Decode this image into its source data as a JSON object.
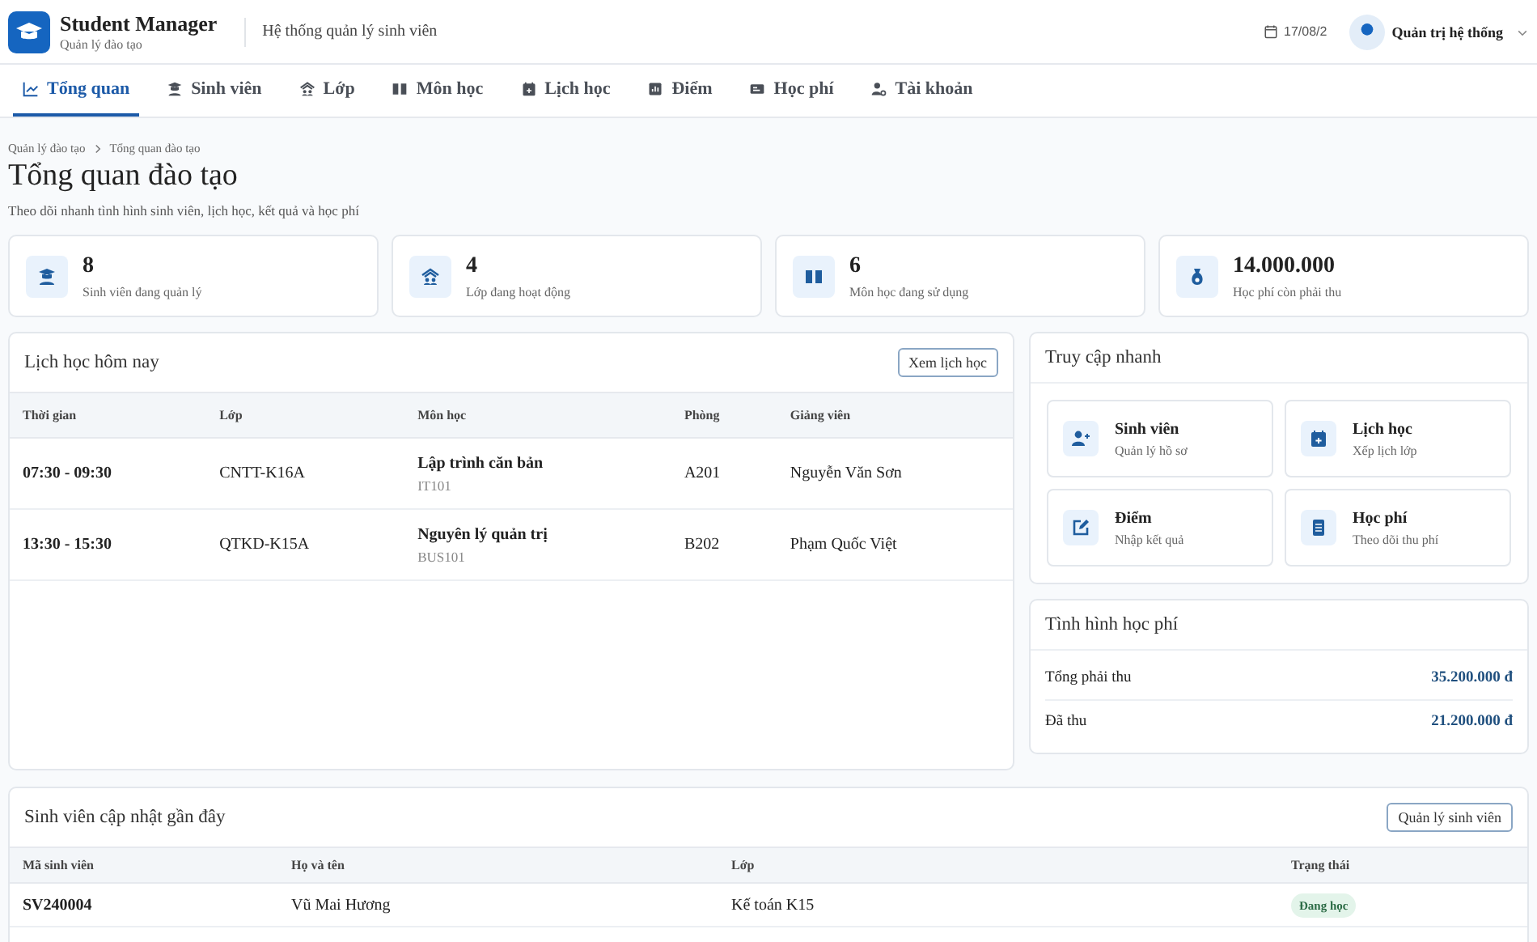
{
  "header": {
    "app_name": "Student Manager",
    "app_subtitle": "Quản lý đào tạo",
    "system_title": "Hệ thống quản lý sinh viên",
    "date": "17/08/2",
    "user_name": "Quản trị hệ thống"
  },
  "tabs": [
    {
      "label": "Tổng quan",
      "kind": "chart",
      "selected": true
    },
    {
      "label": "Sinh viên",
      "kind": "student",
      "selected": false
    },
    {
      "label": "Lớp",
      "kind": "class",
      "selected": false
    },
    {
      "label": "Môn học",
      "kind": "book",
      "selected": false
    },
    {
      "label": "Lịch học",
      "kind": "calendar",
      "selected": false
    },
    {
      "label": "Điểm",
      "kind": "grade",
      "selected": false
    },
    {
      "label": "Học phí",
      "kind": "card",
      "selected": false
    },
    {
      "label": "Tài khoản",
      "kind": "account",
      "selected": false
    }
  ],
  "breadcrumb": [
    "Quản lý đào tạo",
    "Tổng quan đào tạo"
  ],
  "page_title": "Tổng quan đào tạo",
  "page_subtitle": "Theo dõi nhanh tình hình sinh viên, lịch học, kết quả và học phí",
  "stats": [
    {
      "kind": "student",
      "value": "8",
      "label": "Sinh viên đang quản lý"
    },
    {
      "kind": "class",
      "value": "4",
      "label": "Lớp đang hoạt động"
    },
    {
      "kind": "book",
      "value": "6",
      "label": "Môn học đang sử dụng"
    },
    {
      "kind": "money",
      "value": "14.000.000",
      "label": "Học phí còn phải thu"
    }
  ],
  "schedule": {
    "title": "Lịch học hôm nay",
    "button": "Xem lịch học",
    "columns": [
      "Thời gian",
      "Lớp",
      "Môn học",
      "Phòng",
      "Giảng viên"
    ],
    "rows": [
      {
        "time": "07:30 - 09:30",
        "class": "CNTT-K16A",
        "subject": "Lập trình căn bản",
        "subject_code": "IT101",
        "room": "A201",
        "teacher": "Nguyễn Văn Sơn"
      },
      {
        "time": "13:30 - 15:30",
        "class": "QTKD-K15A",
        "subject": "Nguyên lý quản trị",
        "subject_code": "BUS101",
        "room": "B202",
        "teacher": "Phạm Quốc Việt"
      }
    ]
  },
  "quick_access": {
    "title": "Truy cập nhanh",
    "items": [
      {
        "kind": "add-user",
        "title": "Sinh viên",
        "subtitle": "Quản lý hồ sơ"
      },
      {
        "kind": "calendar",
        "title": "Lịch học",
        "subtitle": "Xếp lịch lớp"
      },
      {
        "kind": "edit",
        "title": "Điểm",
        "subtitle": "Nhập kết quả"
      },
      {
        "kind": "document",
        "title": "Học phí",
        "subtitle": "Theo dõi thu phí"
      }
    ]
  },
  "fees": {
    "title": "Tình hình học phí",
    "rows": [
      {
        "label": "Tổng phải thu",
        "value": "35.200.000 đ"
      },
      {
        "label": "Đã thu",
        "value": "21.200.000 đ"
      }
    ]
  },
  "recent_students": {
    "title": "Sinh viên cập nhật gần đây",
    "button": "Quản lý sinh viên",
    "columns": [
      "Mã sinh viên",
      "Họ và tên",
      "Lớp",
      "Trạng thái"
    ],
    "rows": [
      {
        "id": "SV240004",
        "name": "Vũ Mai Hương",
        "class": "Kế toán K15",
        "status": "Đang học",
        "color": "#e3f4ea"
      }
    ]
  }
}
